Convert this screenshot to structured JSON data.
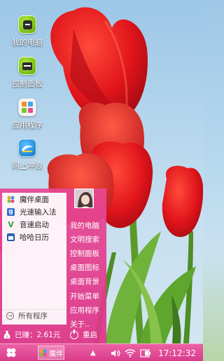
{
  "desktop": {
    "icons": [
      {
        "label": "我的电脑",
        "icon": "my-computer-icon"
      },
      {
        "label": "控制面板",
        "icon": "control-panel-icon"
      },
      {
        "label": "应用程序",
        "icon": "applications-icon"
      },
      {
        "label": "网上冲浪",
        "icon": "internet-surf-icon"
      }
    ]
  },
  "start_menu": {
    "pinned_items": [
      {
        "label": "魔伴桌面",
        "icon": "mobo-desktop-icon"
      },
      {
        "label": "光速输入法",
        "icon": "input-method-icon"
      },
      {
        "label": "音速启动",
        "icon": "sonic-launcher-icon"
      },
      {
        "label": "哈哈日历",
        "icon": "calendar-icon"
      }
    ],
    "all_programs_label": "所有程序",
    "right_links": [
      "我的电脑",
      "文明搜索",
      "控制面板",
      "桌面图标",
      "桌面背景",
      "开始菜单",
      "应用程序",
      "关于.."
    ],
    "earned_label": "已赚：2.61元",
    "restart_label": "重启"
  },
  "taskbar": {
    "app_label": "魔伴",
    "clock": "17:12:32",
    "tray_icons": [
      "tray-up-arrow-icon",
      "volume-icon",
      "wifi-icon",
      "battery-icon"
    ]
  },
  "colors": {
    "accent": "#e0418f",
    "taskbar_top": "#ec62a5",
    "taskbar_bottom": "#d93b8b",
    "icon_green": "#7cc61a",
    "sky": "#a9cfea"
  }
}
